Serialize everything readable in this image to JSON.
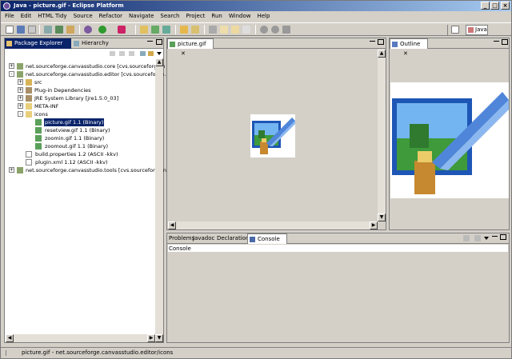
{
  "window": {
    "title": "Java - picture.gif - Eclipse Platform"
  },
  "menu": [
    "File",
    "Edit",
    "HTML Tidy",
    "Source",
    "Refactor",
    "Navigate",
    "Search",
    "Project",
    "Run",
    "Window",
    "Help"
  ],
  "perspective": {
    "label": "Java"
  },
  "left_panel": {
    "tabs": [
      "Package Explorer",
      "Hierarchy"
    ],
    "tree": [
      {
        "label": "net.sourceforge.canvasstudio.core   [cvs.sourceforge.n",
        "indent": 0,
        "expander": "+",
        "icon": "project-icon"
      },
      {
        "label": "net.sourceforge.canvasstudio.editor   [cvs.sourceforge.n",
        "indent": 0,
        "expander": "-",
        "icon": "project-icon"
      },
      {
        "label": "src",
        "indent": 1,
        "expander": "+",
        "icon": "package-folder-icon"
      },
      {
        "label": "Plug-in Dependencies",
        "indent": 1,
        "expander": "+",
        "icon": "library-icon"
      },
      {
        "label": "JRE System Library [jre1.5.0_03]",
        "indent": 1,
        "expander": "+",
        "icon": "library-icon"
      },
      {
        "label": "META-INF",
        "indent": 1,
        "expander": "+",
        "icon": "folder-icon"
      },
      {
        "label": "icons",
        "indent": 1,
        "expander": "-",
        "icon": "folder-icon"
      },
      {
        "label": "picture.gif  1.1  (Binary)",
        "indent": 2,
        "expander": "",
        "icon": "image-file-icon",
        "selected": true
      },
      {
        "label": "resetview.gif  1.1  (Binary)",
        "indent": 2,
        "expander": "",
        "icon": "image-file-icon"
      },
      {
        "label": "zoomin.gif  1.1  (Binary)",
        "indent": 2,
        "expander": "",
        "icon": "image-file-icon"
      },
      {
        "label": "zoomout.gif  1.1  (Binary)",
        "indent": 2,
        "expander": "",
        "icon": "image-file-icon"
      },
      {
        "label": "build.properties  1.2  (ASCII -kkv)",
        "indent": 1,
        "expander": "",
        "icon": "text-file-icon"
      },
      {
        "label": "plugin.xml  1.12  (ASCII -kkv)",
        "indent": 1,
        "expander": "",
        "icon": "text-file-icon"
      },
      {
        "label": "net.sourceforge.canvasstudio.tools   [cvs.sourceforge.n",
        "indent": 0,
        "expander": "+",
        "icon": "project-icon"
      }
    ]
  },
  "editor": {
    "tab": "picture.gif"
  },
  "outline": {
    "tab": "Outline"
  },
  "bottom_panel": {
    "tabs": [
      "Problems",
      "Javadoc",
      "Declaration",
      "Console"
    ],
    "console_label": "Console"
  },
  "status": {
    "text": "picture.gif - net.sourceforge.canvasstudio.editor/icons"
  },
  "colors": {
    "selection": "#0a246a",
    "title_start": "#0a246a",
    "title_end": "#a6caf0",
    "chrome": "#d4d0c8"
  }
}
